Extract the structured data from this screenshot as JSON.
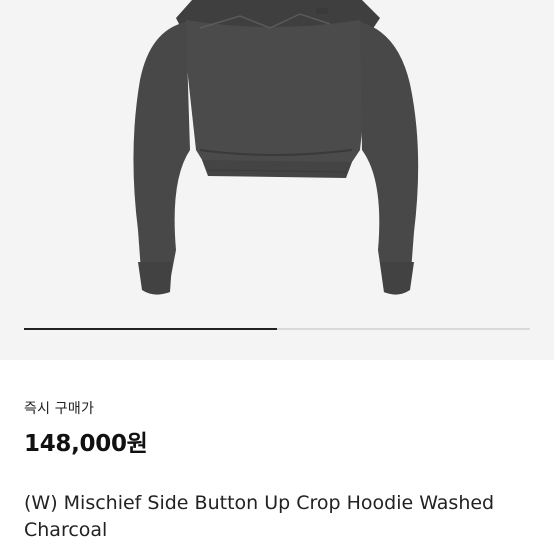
{
  "product": {
    "image_alt": "(W) Mischief Side Button Up Crop Hoodie Washed Charcoal",
    "carousel_progress": 0.5,
    "price_label": "즉시 구매가",
    "price": "148,000원",
    "name": "(W) Mischief Side Button Up Crop Hoodie Washed Charcoal"
  },
  "colors": {
    "garment": "#4a4a4a",
    "background": "#f4f4f4",
    "progress": "#222222"
  }
}
